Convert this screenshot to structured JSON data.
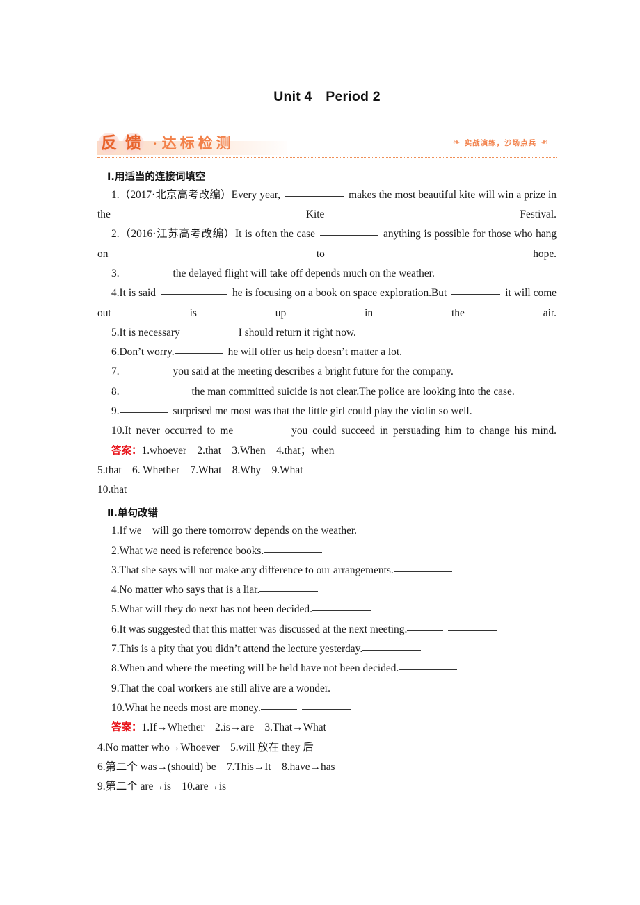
{
  "title": "Unit 4　Period 2",
  "banner": {
    "disc_chars": [
      "反",
      "馈"
    ],
    "dot": "·",
    "word": "达标检测",
    "right_text": "实战演练，沙场点兵",
    "flourish_left": "❧",
    "flourish_right": "❧",
    "accent_color": "#ef7b3e",
    "disc_color": "#e8622a",
    "rule_color": "#f08a4f"
  },
  "sections": [
    {
      "heading": "Ⅰ.用适当的连接词填空",
      "questions": [
        {
          "num": "1.",
          "pre": "（2017·北京高考改编）Every year,",
          "post": "makes the most beautiful kite will win a prize in the Kite Festival."
        },
        {
          "num": "2.",
          "pre": "（2016·江苏高考改编）It is often the case",
          "post": "anything is possible for those who hang on to hope."
        },
        {
          "num": "3.",
          "pre": "",
          "post": "the delayed flight will take off depends much on the weather."
        },
        {
          "num": "4.",
          "pre": "It is said",
          "mid": "he is focusing on a book on space exploration.But",
          "post": "it will come out is up in the air."
        },
        {
          "num": "5.",
          "pre": "It is necessary",
          "post": "I should return it right now."
        },
        {
          "num": "6.",
          "pre": "Don’t worry.",
          "post": "he will offer us help doesn’t matter a lot."
        },
        {
          "num": "7.",
          "pre": "",
          "post": "you said at the meeting describes a bright future for the company."
        },
        {
          "num": "8.",
          "pre": "",
          "post": "the man committed suicide is not clear.The police are looking into the case."
        },
        {
          "num": "9.",
          "pre": "",
          "post": "surprised me most was that the little girl could play the violin so well."
        },
        {
          "num": "10.",
          "pre": "It never occurred to me",
          "post": "you could succeed in persuading him to change his mind."
        }
      ],
      "answer_label": "答案：",
      "answer_lines": [
        "1.whoever　2.that　3.When　4.that；when",
        "5.that　6. Whether　7.What　8.Why　9.What",
        "10.that"
      ]
    },
    {
      "heading": "Ⅱ.单句改错",
      "questions": [
        {
          "num": "1.",
          "text": "If we　will go there tomorrow depends on the weather."
        },
        {
          "num": "2.",
          "text": "What we need is reference books."
        },
        {
          "num": "3.",
          "text": "That she says will not make any difference to our arrangements."
        },
        {
          "num": "4.",
          "text": "No matter who says that is a liar."
        },
        {
          "num": "5.",
          "text": "What will they do next has not been decided."
        },
        {
          "num": "6.",
          "text": "It was suggested that this matter was discussed at the next meeting."
        },
        {
          "num": "7.",
          "text": "This is a pity that you didn’t attend the lecture yesterday."
        },
        {
          "num": "8.",
          "text": "When and where the meeting will be held have not been decided."
        },
        {
          "num": "9.",
          "text": "That the coal workers are still alive are a wonder."
        },
        {
          "num": "10.",
          "text": "What he needs most are money."
        }
      ],
      "answer_label": "答案：",
      "answer_lines": [
        "1.If→Whether　2.is→are　3.That→What",
        "4.No matter who→Whoever　5.will 放在 they 后",
        "6.第二个 was→(should) be　7.This→It　8.have→has",
        "9.第二个 are→is　10.are→is"
      ]
    }
  ]
}
